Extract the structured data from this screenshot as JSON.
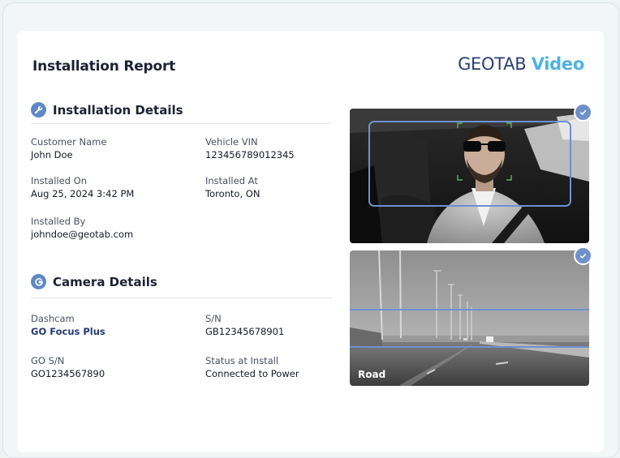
{
  "report": {
    "title": "Installation Report",
    "brand_main": "GEOTAB",
    "brand_sub": "Video"
  },
  "installation_details": {
    "title": "Installation Details",
    "icon": "wrench-icon",
    "customer_name_label": "Customer Name",
    "customer_name": "John Doe",
    "vehicle_vin_label": "Vehicle VIN",
    "vehicle_vin": "123456789012345",
    "installed_on_label": "Installed On",
    "installed_on": "Aug 25, 2024 3:42 PM",
    "installed_at_label": "Installed At",
    "installed_at": "Toronto, ON",
    "installed_by_label": "Installed By",
    "installed_by": "johndoe@geotab.com"
  },
  "camera_details": {
    "title": "Camera Details",
    "icon": "geotab-g-icon",
    "dashcam_label": "Dashcam",
    "dashcam": "GO Focus Plus",
    "sn_label": "S/N",
    "sn": "GB12345678901",
    "go_sn_label": "GO S/N",
    "go_sn": "GO1234567890",
    "status_label": "Status at Install",
    "status": "Connected to Power"
  },
  "images": {
    "driver_camera_icon": "check-icon",
    "road_camera_icon": "check-icon",
    "road_label": "Road"
  },
  "colors": {
    "accent": "#5f88c6",
    "brand_dark": "#2a3f6f",
    "brand_light": "#4fb2e0",
    "overlay_box": "#6f8fd0",
    "face_box": "#5fb35f"
  }
}
